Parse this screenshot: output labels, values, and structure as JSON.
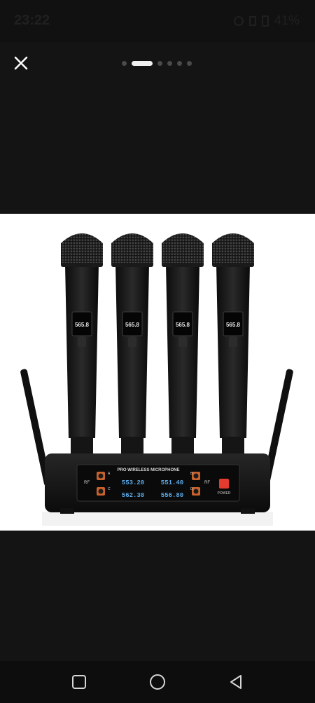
{
  "status_bar": {
    "time": "23:22",
    "battery": "41%",
    "icons": [
      "alarm-icon",
      "signal-icon",
      "battery-icon"
    ]
  },
  "viewer": {
    "pager": {
      "total": 6,
      "active_index": 1
    },
    "close_icon": "close-icon"
  },
  "product_image": {
    "receiver_label": "PRO WIRELESS MICROPHONE",
    "power_label": "POWER",
    "rf_label": "RF",
    "channels": [
      {
        "letter": "A",
        "freq": "553.20"
      },
      {
        "letter": "B",
        "freq": "551.40"
      },
      {
        "letter": "C",
        "freq": "562.30"
      },
      {
        "letter": "D",
        "freq": "556.80"
      }
    ],
    "mic_display": "565.8"
  },
  "nav_bar": {
    "buttons": [
      "recents-button",
      "home-button",
      "back-button"
    ]
  },
  "colors": {
    "background": "#141414",
    "accent_power": "#e33b2e",
    "display_blue": "#5aa8e6"
  }
}
